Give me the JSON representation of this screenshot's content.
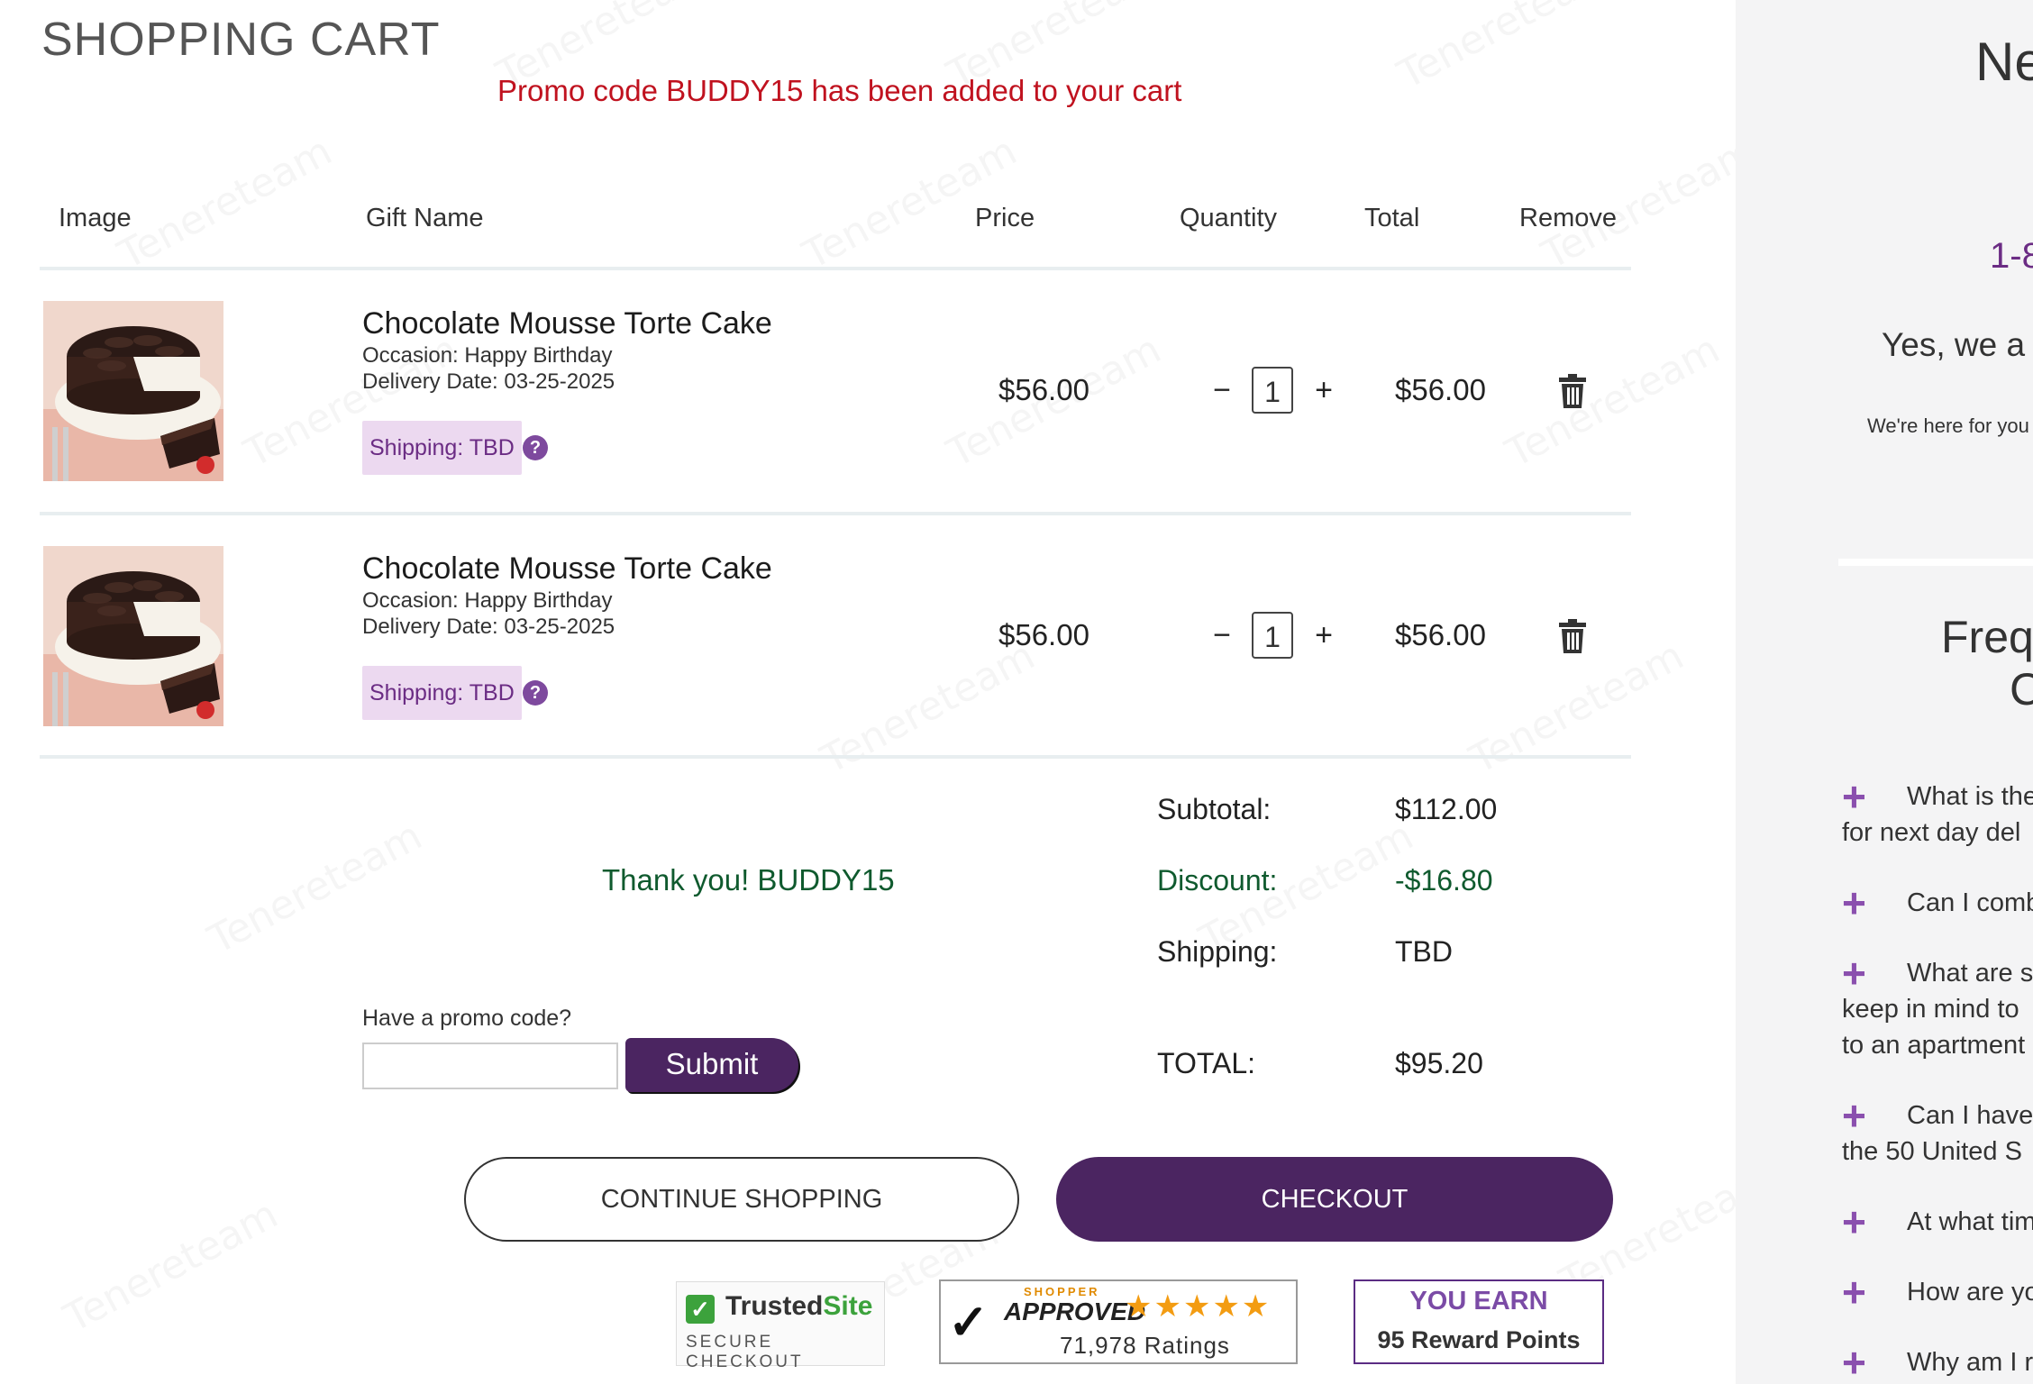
{
  "header": {
    "title": "SHOPPING CART",
    "promo_message": "Promo code BUDDY15 has been added to your cart"
  },
  "table": {
    "columns": [
      "Image",
      "Gift Name",
      "Price",
      "Quantity",
      "Total",
      "Remove"
    ],
    "rows": [
      {
        "gift_name": "Chocolate Mousse Torte Cake",
        "occasion": "Occasion: Happy Birthday",
        "delivery_date": "Delivery Date: 03-25-2025",
        "shipping": "Shipping: TBD",
        "price": "$56.00",
        "quantity": "1",
        "total": "$56.00"
      },
      {
        "gift_name": "Chocolate Mousse Torte Cake",
        "occasion": "Occasion: Happy Birthday",
        "delivery_date": "Delivery Date: 03-25-2025",
        "shipping": "Shipping: TBD",
        "price": "$56.00",
        "quantity": "1",
        "total": "$56.00"
      }
    ],
    "qty_minus": "−",
    "qty_plus": "+",
    "help_icon": "?"
  },
  "summary": {
    "subtotal_label": "Subtotal:",
    "subtotal_value": "$112.00",
    "discount_label": "Discount:",
    "discount_value": "-$16.80",
    "shipping_label": "Shipping:",
    "shipping_value": "TBD",
    "total_label": "TOTAL:",
    "total_value": "$95.20",
    "thanks": "Thank you! BUDDY15"
  },
  "promo": {
    "label": "Have a promo code?",
    "input_value": "",
    "input_placeholder": "",
    "submit_label": "Submit"
  },
  "actions": {
    "continue_label": "CONTINUE SHOPPING",
    "checkout_label": "CHECKOUT"
  },
  "badges": {
    "trusted_site_1": "Trusted",
    "trusted_site_2": "Site",
    "trusted_site_sub": "SECURE CHECKOUT",
    "shopper_top": "SHOPPER",
    "shopper_approved": "APPROVED",
    "shopper_stars": "★★★★★",
    "shopper_ratings": "71,978 Ratings",
    "reward_line1": "YOU EARN",
    "reward_line2": "95 Reward Points"
  },
  "sidebar": {
    "heading": "Ne",
    "phone": "1-8",
    "yes_text": "Yes, we a",
    "here_text": "We're here for you",
    "faq_heading_1": "Freq",
    "faq_heading_2": "C",
    "faq": [
      {
        "line1": "What is the",
        "line2": "for next day del"
      },
      {
        "line1": "Can I comb"
      },
      {
        "line1": "What are s",
        "line2": "keep in mind to",
        "line3": "to an apartment"
      },
      {
        "line1": "Can I have",
        "line2": "the 50 United S"
      },
      {
        "line1": "At what tim"
      },
      {
        "line1": "How are yo"
      },
      {
        "line1": "Why am I r"
      }
    ]
  },
  "watermark": "Tenereteam",
  "colors": {
    "brand_purple": "#4b2561",
    "promo_red": "#c0121f",
    "discount_green": "#0f5a2e",
    "shipping_tag_bg": "#ecd9f0"
  },
  "icons": {
    "remove": "trash-icon",
    "help": "question-circle-icon",
    "faq_expand": "plus-icon"
  }
}
